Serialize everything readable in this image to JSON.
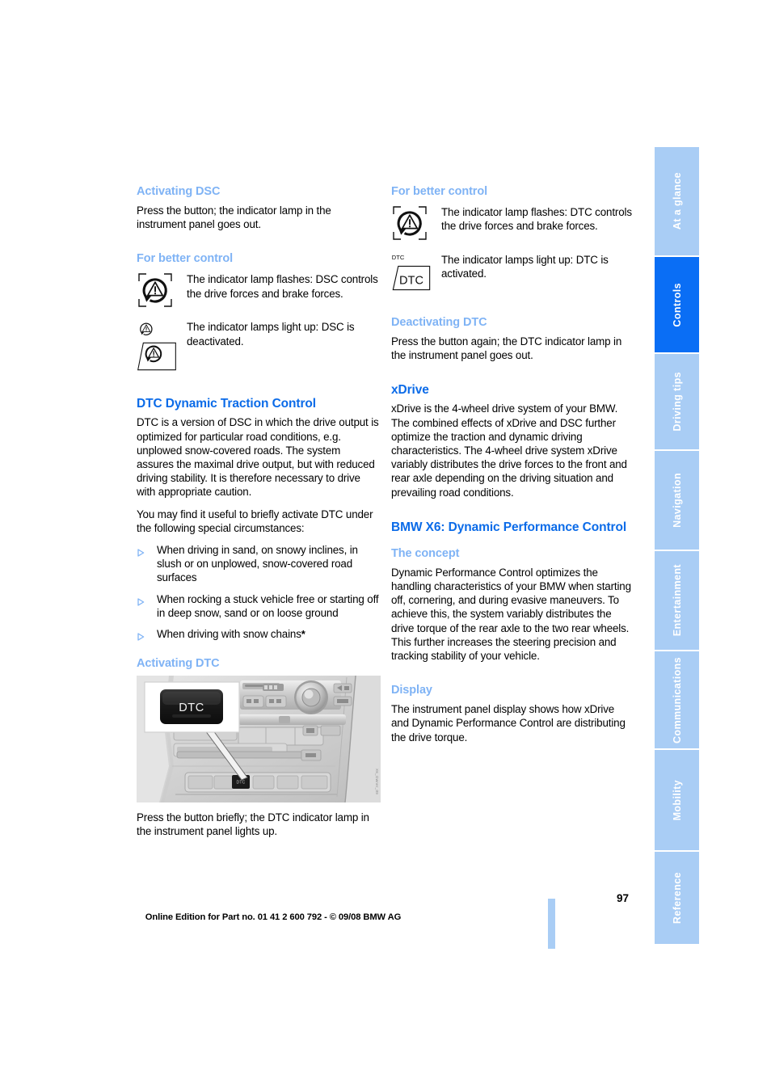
{
  "document": {
    "page_number": "97",
    "edition_line": "Online Edition for Part no. 01 41 2 600 792 - © 09/08 BMW AG",
    "photo_credit": "X6_Owner_09"
  },
  "colors": {
    "heading_primary": "#0b6be8",
    "heading_secondary": "#7fb3f5",
    "tab_inactive": "#a9cdf5",
    "tab_active": "#0a6ef5",
    "body_text": "#000000"
  },
  "sidebar": {
    "tabs": [
      {
        "label": "At a glance",
        "active": false
      },
      {
        "label": "Controls",
        "active": true
      },
      {
        "label": "Driving tips",
        "active": false
      },
      {
        "label": "Navigation",
        "active": false
      },
      {
        "label": "Entertainment",
        "active": false
      },
      {
        "label": "Communications",
        "active": false
      },
      {
        "label": "Mobility",
        "active": false
      },
      {
        "label": "Reference",
        "active": false
      }
    ]
  },
  "left_column": {
    "activating_dsc": {
      "heading": "Activating DSC",
      "body": "Press the button; the indicator lamp in the instrument panel goes out."
    },
    "for_better_control": {
      "heading": "For better control",
      "items": [
        {
          "icon": "dsc-flashing-lamp-icon",
          "text": "The indicator lamp flashes: DSC controls the drive forces and brake forces."
        },
        {
          "icon": "dsc-off-lamp-icon",
          "text": "The indicator lamps light up: DSC is deactivated."
        }
      ]
    },
    "dtc_section": {
      "heading": "DTC Dynamic Traction Control",
      "paragraph_1": "DTC is a version of DSC in which the drive output is optimized for particular road conditions, e.g. unplowed snow-covered roads. The system assures the maximal drive output, but with reduced driving stability. It is therefore necessary to drive with appropriate caution.",
      "paragraph_2": "You may find it useful to briefly activate DTC under the following special circumstances:",
      "bullets": [
        "When driving in sand, on snowy inclines, in slush or on unplowed, snow-covered road surfaces",
        "When rocking a stuck vehicle free or starting off in deep snow, sand or on loose ground",
        "When driving with snow chains"
      ],
      "bullet_3_suffix": "*"
    },
    "activating_dtc": {
      "heading": "Activating DTC",
      "photo_alt": "center-console-dtc-button-photo",
      "button_label": "DTC",
      "body": "Press the button briefly; the DTC indicator lamp in the instrument panel lights up."
    }
  },
  "right_column": {
    "for_better_control": {
      "heading": "For better control",
      "items": [
        {
          "icon": "dtc-flashing-lamp-icon",
          "text": "The indicator lamp flashes: DTC controls the drive forces and brake forces."
        },
        {
          "icon": "dtc-on-lamp-icon",
          "icon_label": "DTC",
          "text": "The indicator lamps light up: DTC is activated."
        }
      ]
    },
    "deactivating_dtc": {
      "heading": "Deactivating DTC",
      "body": "Press the button again; the DTC indicator lamp in the instrument panel goes out."
    },
    "xdrive": {
      "heading": "xDrive",
      "body": "xDrive is the 4-wheel drive system of your BMW. The combined effects of xDrive and DSC further optimize the traction and dynamic driving characteristics. The 4-wheel drive system xDrive variably distributes the drive forces to the front and rear axle depending on the driving situation and prevailing road conditions."
    },
    "dpc": {
      "heading": "BMW X6: Dynamic Performance Control",
      "concept_heading": "The concept",
      "concept_body": "Dynamic Performance Control optimizes the handling characteristics of your BMW when starting off, cornering, and during evasive maneuvers. To achieve this, the system variably distributes the drive torque of the rear axle to the two rear wheels. This further increases the steering precision and tracking stability of your vehicle.",
      "display_heading": "Display",
      "display_body": "The instrument panel display shows how xDrive and Dynamic Performance Control are distributing the drive torque."
    }
  }
}
